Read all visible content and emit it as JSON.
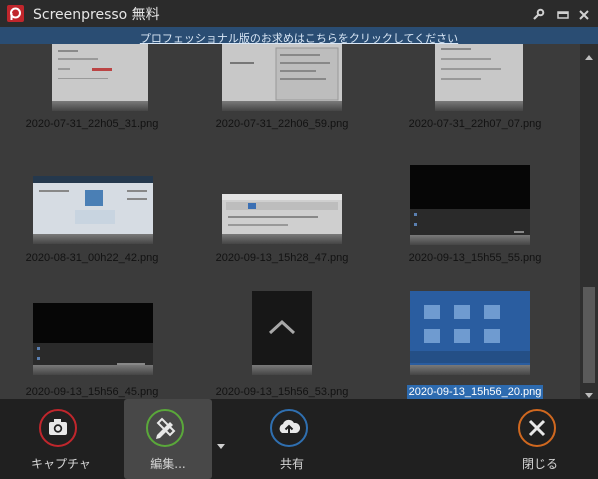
{
  "app": {
    "title": "Screenpresso 無料"
  },
  "promo": {
    "text": "プロフェッショナル版のお求めはこちらをクリックしてください"
  },
  "gallery": {
    "items": [
      {
        "name": "2020-07-31_22h05_31.png",
        "selected": false
      },
      {
        "name": "2020-07-31_22h06_59.png",
        "selected": false
      },
      {
        "name": "2020-07-31_22h07_07.png",
        "selected": false
      },
      {
        "name": "2020-08-31_00h22_42.png",
        "selected": false
      },
      {
        "name": "2020-09-13_15h28_47.png",
        "selected": false
      },
      {
        "name": "2020-09-13_15h55_55.png",
        "selected": false
      },
      {
        "name": "2020-09-13_15h56_45.png",
        "selected": false
      },
      {
        "name": "2020-09-13_15h56_53.png",
        "selected": false
      },
      {
        "name": "2020-09-13_15h56_20.png",
        "selected": true
      }
    ]
  },
  "toolbar": {
    "capture_label": "キャプチャ",
    "edit_label": "編集...",
    "share_label": "共有",
    "close_label": "閉じる"
  },
  "colors": {
    "capture_ring": "#c0262c",
    "edit_ring": "#5aa83a",
    "share_ring": "#2f6fb0",
    "close_ring": "#d0681f",
    "selection": "#2d6bb0"
  }
}
